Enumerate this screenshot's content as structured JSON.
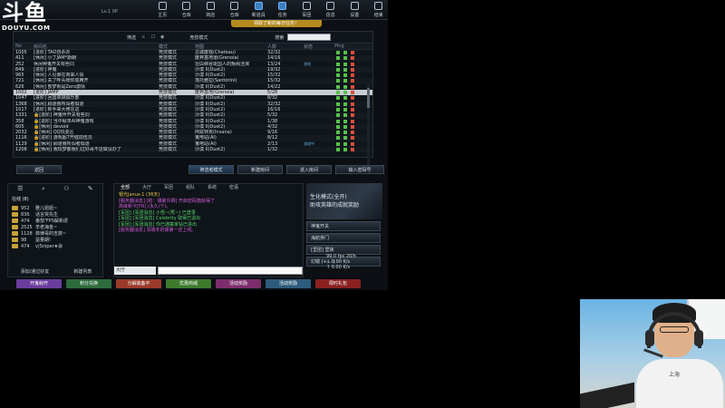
{
  "watermark": {
    "logo": "斗鱼",
    "url": "DOUYU.COM"
  },
  "player": {
    "level": "Lv.1 0P"
  },
  "topnav": [
    "主页",
    "仓库",
    "商店",
    "仓库",
    "新道具",
    "任务",
    "军团",
    "信息",
    "设置",
    "结束"
  ],
  "notice": "领取了新的每日任务！",
  "filter": {
    "label": "筛选",
    "mode": "竞技模式",
    "search": "搜索"
  },
  "columns": [
    "No",
    "房间名",
    "模式",
    "地图",
    "人数",
    "状态",
    "Ping"
  ],
  "rooms": [
    {
      "no": "1005",
      "name": "[进阶] TAO自杀办",
      "mode": "竞技模式",
      "map": "古城废墟(Chateau)",
      "count": "32/32",
      "status": "",
      "lock": false
    },
    {
      "no": "411",
      "name": "[休闲] 小丁JAM*斯朗",
      "mode": "竞技模式",
      "map": "废弃基地道(Grenoia)",
      "count": "14/16",
      "status": "",
      "lock": false
    },
    {
      "no": "252",
      "name": "休闲种鬼开关有些同",
      "mode": "竞技模式",
      "map": "坦白峡谷斑国人的叛阁洼演",
      "count": "13/24",
      "status": "游戏",
      "lock": false
    },
    {
      "no": "849",
      "name": "[进阶] 神鬼",
      "mode": "竞技模式",
      "map": "沙漠 II(Dust2)",
      "count": "19/32",
      "status": "",
      "lock": false
    },
    {
      "no": "965",
      "name": "[休闲] 人见谁在商来人情",
      "mode": "竞技模式",
      "map": "沙漠 II(Dust2)",
      "count": "15/32",
      "status": "",
      "lock": false
    },
    {
      "no": "721",
      "name": "[休闲] 关了呼头帐你成两开",
      "mode": "竞技模式",
      "map": "落托雅拉(Santorini)",
      "count": "15/32",
      "status": "",
      "lock": false
    },
    {
      "no": "626",
      "name": "[休闲] 部梦就是Zero激情",
      "mode": "竞技模式",
      "map": "沙漠 II(Dust2)",
      "count": "14/22",
      "status": "",
      "lock": false
    },
    {
      "no": "1002",
      "name": "[进阶] JAMP",
      "mode": "竞技模式",
      "map": "废弃基地(Grenoia)",
      "count": "5/28",
      "status": "",
      "lock": false,
      "selected": true
    },
    {
      "no": "1047",
      "name": "[进阶] 回国单挑俱乐部",
      "mode": "竞技模式",
      "map": "沙漠 II(Dust2)",
      "count": "8/32",
      "status": "",
      "lock": false
    },
    {
      "no": "1368",
      "name": "[休闲] 顾道赛所闯者俱道",
      "mode": "竞技模式",
      "map": "沙漠 II(Dust2)",
      "count": "32/32",
      "status": "",
      "lock": false
    },
    {
      "no": "1017",
      "name": "[进阶] 新手来大佬在这",
      "mode": "竞技模式",
      "map": "沙漠 II(Dust2)",
      "count": "16/16",
      "status": "",
      "lock": false
    },
    {
      "no": "1331",
      "name": "[进阶] 神鬼伴开关有些同",
      "mode": "竞技模式",
      "map": "沙漠 II(Dust2)",
      "count": "5/32",
      "status": "",
      "lock": true
    },
    {
      "no": "358",
      "name": "[进阶] 当中就单AI神鬼游戏",
      "mode": "竞技模式",
      "map": "沙漠 II(Dust2)",
      "count": "1/38",
      "status": "",
      "lock": true
    },
    {
      "no": "605",
      "name": "[休闲] devoid",
      "mode": "竞技模式",
      "map": "沙漠 II(Dust2)",
      "count": "4/32",
      "status": "",
      "lock": true
    },
    {
      "no": "2032",
      "name": "[休闲] QQ玩耍区",
      "mode": "竞技模式",
      "map": "阿兹特克(Inxana)",
      "count": "9/16",
      "status": "",
      "lock": true
    },
    {
      "no": "1116",
      "name": "[进阶] 游戏超7开催前伍员",
      "mode": "竞技模式",
      "map": "鬼电站(AI)",
      "count": "8/12",
      "status": "",
      "lock": true
    },
    {
      "no": "1129",
      "name": "[休闲] 顾道赛所闯者俱道",
      "mode": "竞技模式",
      "map": "鬼电站(AI)",
      "count": "2/13",
      "status": "游戏中",
      "lock": true
    },
    {
      "no": "1208",
      "name": "[休闲] 我玩梦都我们过好哥不这做没办了",
      "mode": "竞技模式",
      "map": "沙漠 II(Dust2)",
      "count": "1/32",
      "status": "",
      "lock": true
    }
  ],
  "buttons": {
    "back": "返回",
    "filtered": "筛选者模式",
    "create": "新建房间",
    "enter": "进入房间",
    "pwd": "输入密码号"
  },
  "friends": {
    "group": "在线 (8)",
    "list": [
      {
        "num": "952",
        "name": "雅儿姐姐~"
      },
      {
        "num": "836",
        "name": "话言突先生"
      },
      {
        "num": "474",
        "name": "番茄ᵀFPS解新虐"
      },
      {
        "num": "2525",
        "name": "辛老海金~"
      },
      {
        "num": "1128",
        "name": "菲律哥的吉旅~"
      },
      {
        "num": "98",
        "name": "益量期!"
      },
      {
        "num": "474",
        "name": "v|Sniper★会"
      }
    ],
    "add": "添加/通过好友",
    "new_list": "新建列表"
  },
  "chat": {
    "tabs": [
      "全部",
      "大厅",
      "军团",
      "组队",
      "系统",
      "密语"
    ],
    "messages": [
      {
        "cls": "y",
        "text": "银光Janus-1 (36天)"
      },
      {
        "cls": "m",
        "text": "[服务器消息] [枪：爆破炎狮] 开启密码箱获得了"
      },
      {
        "cls": "m",
        "text": "高级新卡[FR] (永久/个)。"
      },
      {
        "cls": "g",
        "text": "[军团] [军团消息] 小怪~(秀~) 已登录"
      },
      {
        "cls": "g",
        "text": "[军团] [军团消息] Celebrity 取得已退出"
      },
      {
        "cls": "g",
        "text": "[军团] [军团消息] 你已通童家钻已进出"
      },
      {
        "cls": "m",
        "text": "[服务器消息] 羽端冬的爆第一还上线。"
      }
    ],
    "channel": "大厅"
  },
  "side": {
    "banner": "生化模式(全开)\n助攻英雄的成就奖励",
    "items": [
      "神鬼开关",
      "海航排门",
      "[里团] 里锁",
      "幻镜 (+:…)"
    ]
  },
  "stats": {
    "fps": "99.0 fps",
    "ping": "20/h",
    "down": "0.00 K/s",
    "up": "0.00 K/s"
  },
  "bottom": [
    "开鬼射开",
    "积分兑换",
    "分解装备平",
    "优惠商城",
    "活动奖励",
    "活动奖励",
    "限时礼包"
  ],
  "bottom_colors": [
    "#6a3d9c",
    "#2d6b3d",
    "#9a3a2a",
    "#3d7b2d",
    "#7d2d6b",
    "#2d5b7b",
    "#8a2020"
  ],
  "cam": {
    "shirt_text": "上海"
  }
}
